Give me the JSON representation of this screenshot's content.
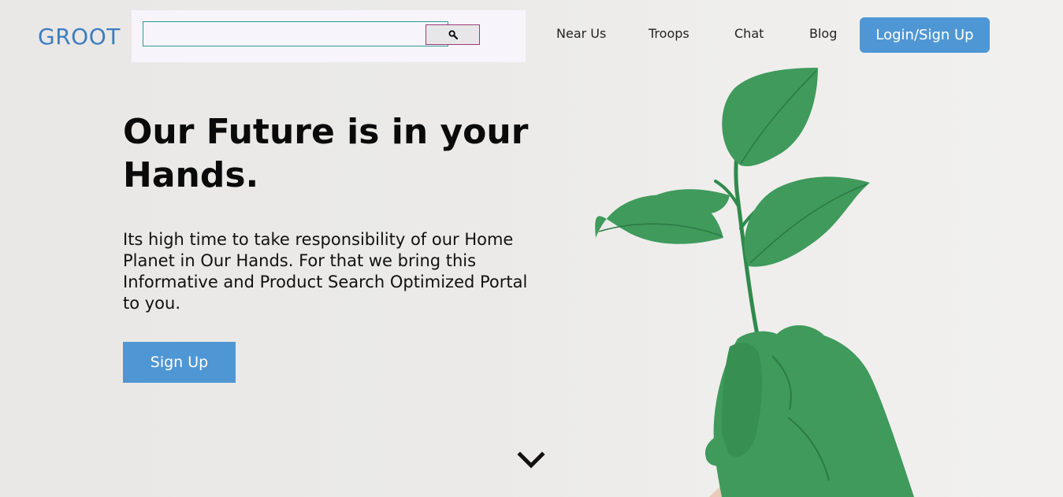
{
  "header": {
    "logo": "GROOT",
    "search": {
      "value": "",
      "placeholder": "",
      "button_icon": "search-icon"
    },
    "nav": {
      "near_us": "Near Us",
      "troops": "Troops",
      "chat": "Chat",
      "blog": "Blog"
    },
    "login_label": "Login/Sign Up"
  },
  "hero": {
    "headline": "Our Future is in your Hands.",
    "subtext": "Its high time to take responsibility of our Home Planet in Our Hands. For that we bring this Informative and Product Search Optimized Portal to you.",
    "signup_label": "Sign Up",
    "scroll_icon": "chevron-down-icon",
    "image": "hand-holding-plant-illustration"
  },
  "colors": {
    "accent": "#4f97d4",
    "logo": "#3e7cc0",
    "leaf_green": "#3f9a5c",
    "background": "#ebeae8",
    "search_panel": "#f7f5fb"
  }
}
